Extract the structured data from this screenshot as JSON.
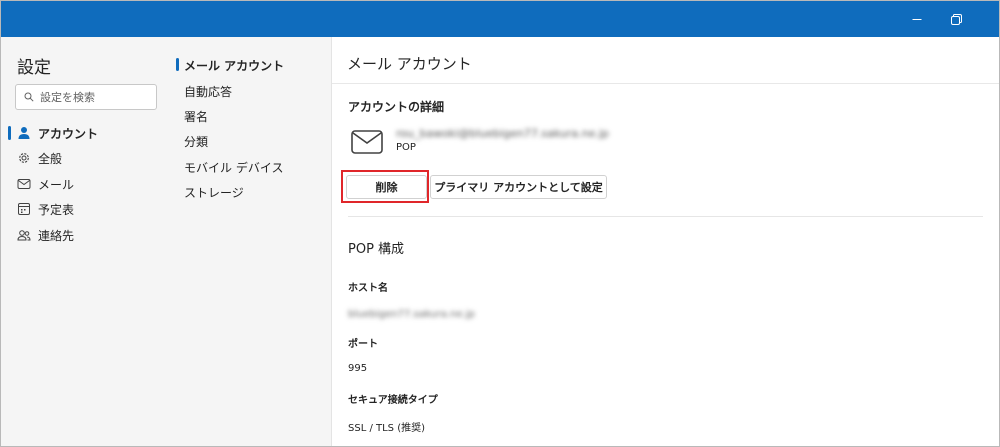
{
  "settings": {
    "title": "設定",
    "search_placeholder": "設定を検索"
  },
  "categories": [
    {
      "label": "アカウント",
      "icon": "person-icon",
      "active": true
    },
    {
      "label": "全般",
      "icon": "gear-icon",
      "active": false
    },
    {
      "label": "メール",
      "icon": "mail-icon",
      "active": false
    },
    {
      "label": "予定表",
      "icon": "calendar-icon",
      "active": false
    },
    {
      "label": "連絡先",
      "icon": "people-icon",
      "active": false
    }
  ],
  "subnav": [
    {
      "label": "メール アカウント",
      "active": true
    },
    {
      "label": "自動応答",
      "active": false
    },
    {
      "label": "署名",
      "active": false
    },
    {
      "label": "分類",
      "active": false
    },
    {
      "label": "モバイル デバイス",
      "active": false
    },
    {
      "label": "ストレージ",
      "active": false
    }
  ],
  "main": {
    "page_title": "メール アカウント",
    "account_details_heading": "アカウントの詳細",
    "account_email": "rou_bawoki@bluebigen77.sakura.ne.jp",
    "account_type": "POP",
    "delete_button": "削除",
    "set_primary_button": "プライマリ アカウントとして設定",
    "pop_section_heading": "POP 構成",
    "host_label": "ホスト名",
    "host_value": "bluebigen77.sakura.ne.jp",
    "port_label": "ポート",
    "port_value": "995",
    "security_label": "セキュア接続タイプ",
    "security_value": "SSL / TLS (推奨)"
  },
  "colors": {
    "titlebar": "#0f6cbd",
    "accent": "#0f6cbd",
    "highlight": "#e0262a"
  }
}
